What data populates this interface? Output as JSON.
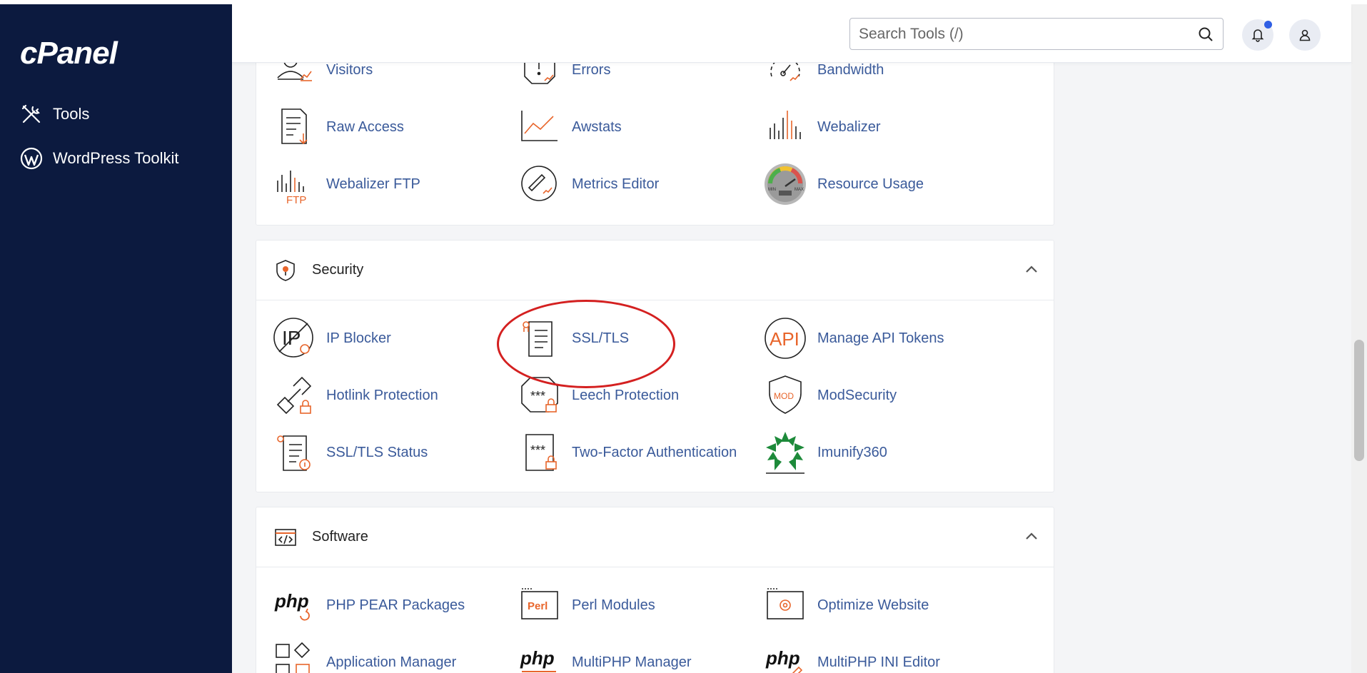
{
  "sidebar": {
    "logo": "cPanel",
    "items": [
      {
        "label": "Tools",
        "icon": "tools-icon"
      },
      {
        "label": "WordPress Toolkit",
        "icon": "wordpress-icon"
      }
    ]
  },
  "header": {
    "search": {
      "placeholder": "Search Tools (/)"
    }
  },
  "metrics_section": {
    "tools": [
      {
        "label": "Visitors"
      },
      {
        "label": "Errors"
      },
      {
        "label": "Bandwidth"
      },
      {
        "label": "Raw Access"
      },
      {
        "label": "Awstats"
      },
      {
        "label": "Webalizer"
      },
      {
        "label": "Webalizer FTP"
      },
      {
        "label": "Metrics Editor"
      },
      {
        "label": "Resource Usage"
      }
    ]
  },
  "security_section": {
    "title": "Security",
    "tools": [
      {
        "label": "IP Blocker"
      },
      {
        "label": "SSL/TLS"
      },
      {
        "label": "Manage API Tokens"
      },
      {
        "label": "Hotlink Protection"
      },
      {
        "label": "Leech Protection"
      },
      {
        "label": "ModSecurity"
      },
      {
        "label": "SSL/TLS Status"
      },
      {
        "label": "Two-Factor Authentication"
      },
      {
        "label": "Imunify360"
      }
    ]
  },
  "software_section": {
    "title": "Software",
    "tools": [
      {
        "label": "PHP PEAR Packages"
      },
      {
        "label": "Perl Modules"
      },
      {
        "label": "Optimize Website"
      },
      {
        "label": "Application Manager"
      },
      {
        "label": "MultiPHP Manager"
      },
      {
        "label": "MultiPHP INI Editor"
      }
    ]
  },
  "icon_text": {
    "ip": "IP",
    "api": "API",
    "mod": "MOD",
    "ftp": "FTP",
    "perl": "Perl",
    "php": "php",
    "stars": "***",
    "gauge_min": "MIN",
    "gauge_max": "MAX"
  },
  "colors": {
    "sidebar_bg": "#0c1a3f",
    "accent_orange": "#e8652b",
    "link_blue": "#3a5a9a",
    "notification_dot": "#2f5ee4",
    "highlight_red": "#d42020"
  }
}
